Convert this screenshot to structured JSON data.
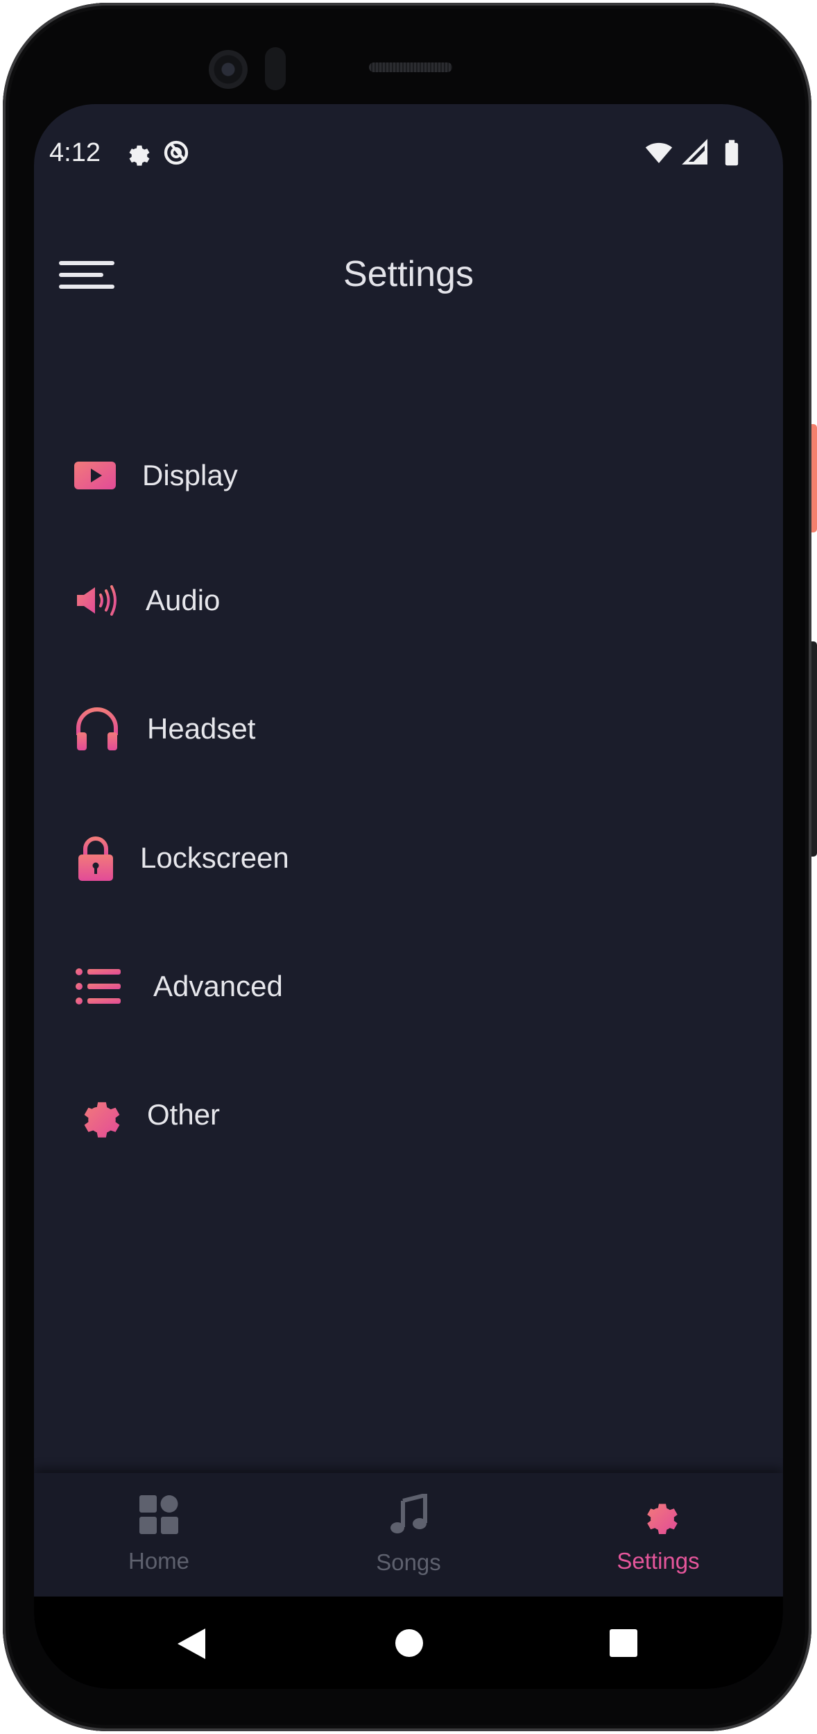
{
  "status_bar": {
    "time": "4:12",
    "left_icons": [
      "gear-icon",
      "at-sign-icon"
    ],
    "right_icons": [
      "wifi-icon",
      "cell-signal-icon",
      "battery-icon"
    ]
  },
  "header": {
    "title": "Settings",
    "menu_icon": "hamburger-menu-icon"
  },
  "settings_items": [
    {
      "label": "Display",
      "icon": "video-play-icon"
    },
    {
      "label": "Audio",
      "icon": "speaker-icon"
    },
    {
      "label": "Headset",
      "icon": "headphones-icon"
    },
    {
      "label": "Lockscreen",
      "icon": "lock-icon"
    },
    {
      "label": "Advanced",
      "icon": "list-icon"
    },
    {
      "label": "Other",
      "icon": "gear-icon"
    }
  ],
  "bottom_nav": {
    "items": [
      {
        "label": "Home",
        "icon": "grid-icon",
        "active": false
      },
      {
        "label": "Songs",
        "icon": "music-note-icon",
        "active": false
      },
      {
        "label": "Settings",
        "icon": "gear-icon",
        "active": true
      }
    ]
  },
  "system_nav": [
    "back-icon",
    "home-circle-icon",
    "recents-square-icon"
  ],
  "colors": {
    "background": "#1b1d2b",
    "nav_background": "#181a27",
    "accent_start": "#f06b83",
    "accent_end": "#e34e95",
    "inactive": "#5e616e",
    "text": "#e6e6ea"
  }
}
